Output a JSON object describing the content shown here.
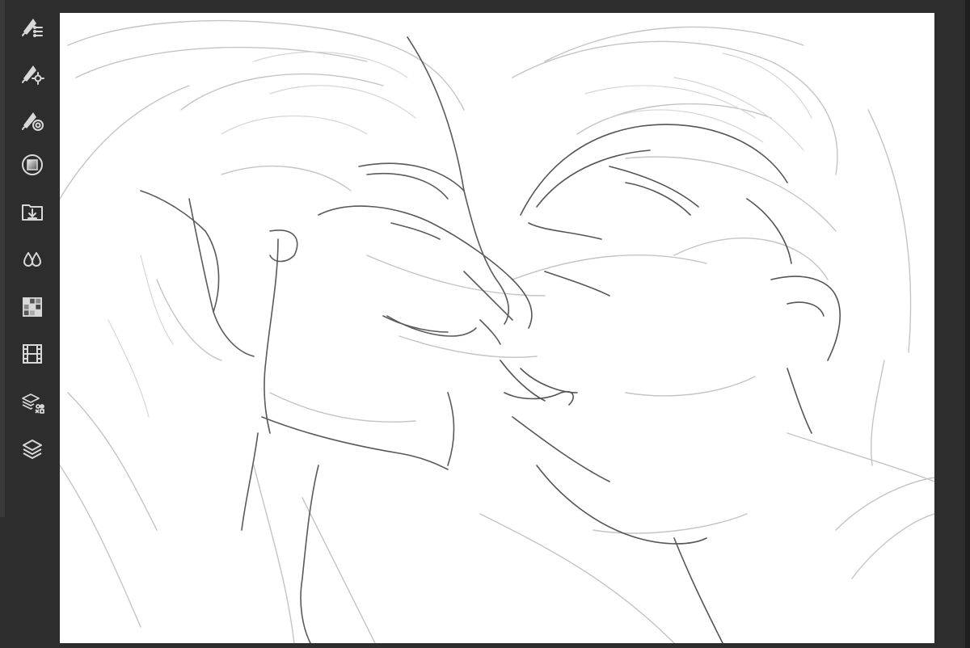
{
  "theme": {
    "ui_background": "#2d2d2d",
    "icon_color": "#d8d8d8",
    "canvas_background": "#ffffff",
    "sketch_dark": "#3a3a3a",
    "sketch_light": "#b8b8b8"
  },
  "toolbar": {
    "tools": [
      {
        "name": "brush-list-icon"
      },
      {
        "name": "brush-settings-icon"
      },
      {
        "name": "brush-target-icon"
      },
      {
        "name": "color-square-icon"
      },
      {
        "name": "import-folder-icon"
      },
      {
        "name": "color-drops-icon"
      },
      {
        "name": "grid-palette-icon"
      },
      {
        "name": "filmstrip-icon"
      },
      {
        "name": "layer-shapes-icon"
      },
      {
        "name": "layers-icon"
      }
    ]
  },
  "canvas": {
    "content": "pencil-sketch"
  }
}
